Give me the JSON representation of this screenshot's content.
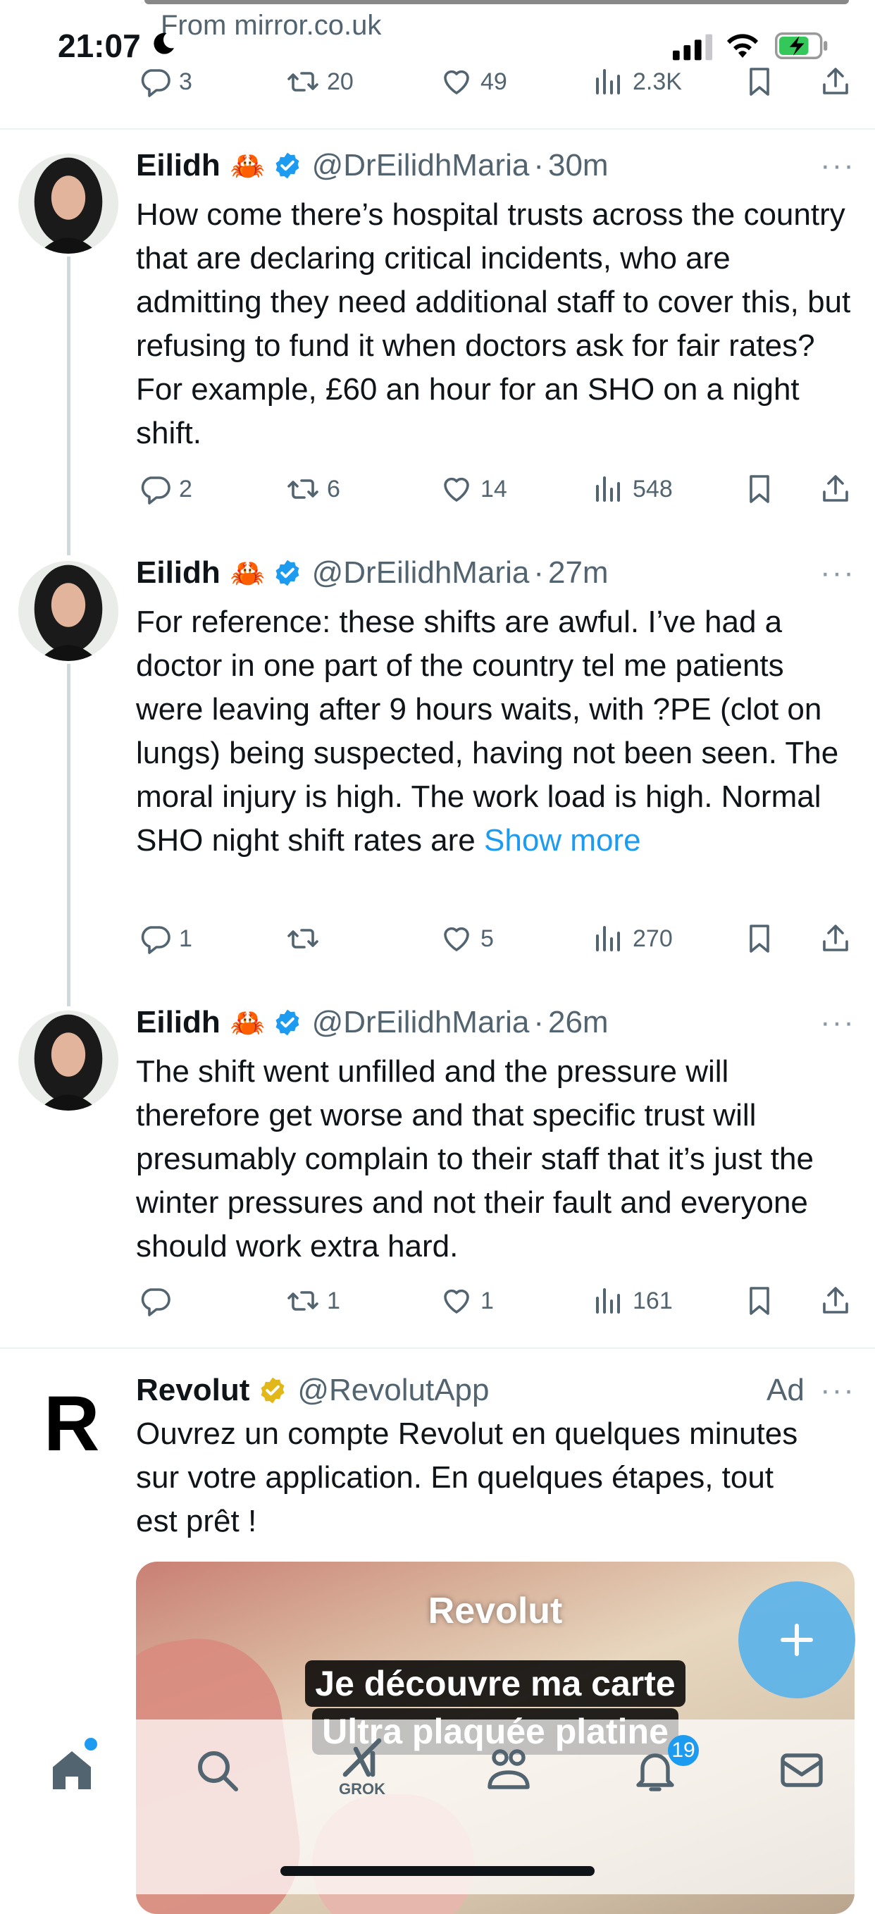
{
  "status_bar": {
    "time": "21:07",
    "source_text": "From mirror.co.uk"
  },
  "previous_tweet": {
    "replies": "3",
    "retweets": "20",
    "likes": "49",
    "views": "2.3K"
  },
  "tweets": [
    {
      "name": "Eilidh",
      "emoji": "🦀",
      "handle": "@DrEilidhMaria",
      "time": "30m",
      "text": "How come there’s hospital trusts across the country that are declaring critical incidents, who are admitting they need additional staff to cover this, but refusing to fund it when doctors ask for fair rates? For example, £60 an hour for an SHO on a night shift.",
      "replies": "2",
      "retweets": "6",
      "likes": "14",
      "views": "548"
    },
    {
      "name": "Eilidh",
      "emoji": "🦀",
      "handle": "@DrEilidhMaria",
      "time": "27m",
      "text": "For reference: these shifts are awful. I’ve had a doctor in one part of the country tel me patients were leaving after 9 hours waits, with ?PE (clot on lungs) being suspected, having not been seen. The moral injury is high. The work load is high. Normal SHO night shift rates are",
      "show_more": "Show more",
      "replies": "1",
      "retweets": "",
      "likes": "5",
      "views": "270"
    },
    {
      "name": "Eilidh",
      "emoji": "🦀",
      "handle": "@DrEilidhMaria",
      "time": "26m",
      "text": "The shift went unfilled and the pressure will therefore get worse and that specific trust will presumably complain to their staff that it’s just the winter pressures and not their fault and everyone should work extra hard.",
      "replies": "",
      "retweets": "1",
      "likes": "1",
      "views": "161"
    }
  ],
  "ad": {
    "name": "Revolut",
    "handle": "@RevolutApp",
    "label": "Ad",
    "logo_letter": "R",
    "text": "Ouvrez un compte Revolut en quelques minutes sur votre application. En quelques étapes, tout est prêt !",
    "media_brand": "Revolut",
    "media_caption_1": "Je découvre ma carte",
    "media_caption_2": "Ultra plaquée platine"
  },
  "tabbar": {
    "grok_label": "GROK",
    "notifications_count": "19"
  },
  "colors": {
    "accent": "#1d9bf0",
    "secondary_text": "#536471",
    "verified_gold": "#e2b719"
  },
  "icons": [
    "moon-icon",
    "signal-icon",
    "wifi-icon",
    "battery-icon",
    "reply-icon",
    "retweet-icon",
    "like-icon",
    "views-icon",
    "bookmark-icon",
    "share-icon",
    "more-icon",
    "verified-badge-icon",
    "plus-icon",
    "home-icon",
    "search-icon",
    "grok-icon",
    "communities-icon",
    "bell-icon",
    "mail-icon"
  ]
}
